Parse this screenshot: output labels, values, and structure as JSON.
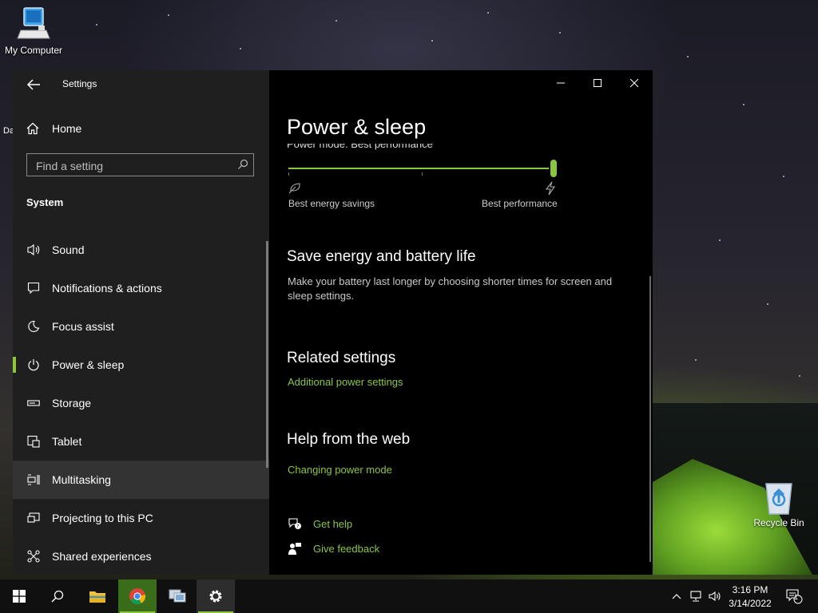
{
  "desktop": {
    "icons": [
      {
        "label": "My Computer"
      },
      {
        "label": "Recycle Bin"
      }
    ],
    "partial_label": "Da"
  },
  "window": {
    "title": "Settings",
    "controls": [
      "minimize-icon",
      "maximize-icon",
      "close-icon"
    ]
  },
  "nav": {
    "home_label": "Home",
    "search_placeholder": "Find a setting",
    "section": "System",
    "items": [
      {
        "label": "Sound",
        "icon": "speaker-icon"
      },
      {
        "label": "Notifications & actions",
        "icon": "notification-icon"
      },
      {
        "label": "Focus assist",
        "icon": "moon-icon"
      },
      {
        "label": "Power & sleep",
        "icon": "power-icon",
        "selected": true
      },
      {
        "label": "Storage",
        "icon": "storage-icon"
      },
      {
        "label": "Tablet",
        "icon": "tablet-icon"
      },
      {
        "label": "Multitasking",
        "icon": "multitasking-icon",
        "hover": true
      },
      {
        "label": "Projecting to this PC",
        "icon": "projecting-icon"
      },
      {
        "label": "Shared experiences",
        "icon": "shared-icon"
      }
    ]
  },
  "main": {
    "title": "Power & sleep",
    "power_mode_label": "Power mode: Best performance",
    "slider": {
      "value": 1.0,
      "left_caption": "Best energy savings",
      "right_caption": "Best performance"
    },
    "save_energy": {
      "heading": "Save energy and battery life",
      "text": "Make your battery last longer by choosing shorter times for screen and sleep settings."
    },
    "related": {
      "heading": "Related settings",
      "link": "Additional power settings"
    },
    "web_help": {
      "heading": "Help from the web",
      "link": "Changing power mode"
    },
    "get_help": "Get help",
    "give_feedback": "Give feedback"
  },
  "taskbar": {
    "clock_time": "3:16 PM",
    "clock_date": "3/14/2022",
    "notification_count": "1"
  },
  "colors": {
    "accent": "#8cc63f",
    "nav_bg": "#1f1f1f",
    "main_bg": "#000000"
  }
}
